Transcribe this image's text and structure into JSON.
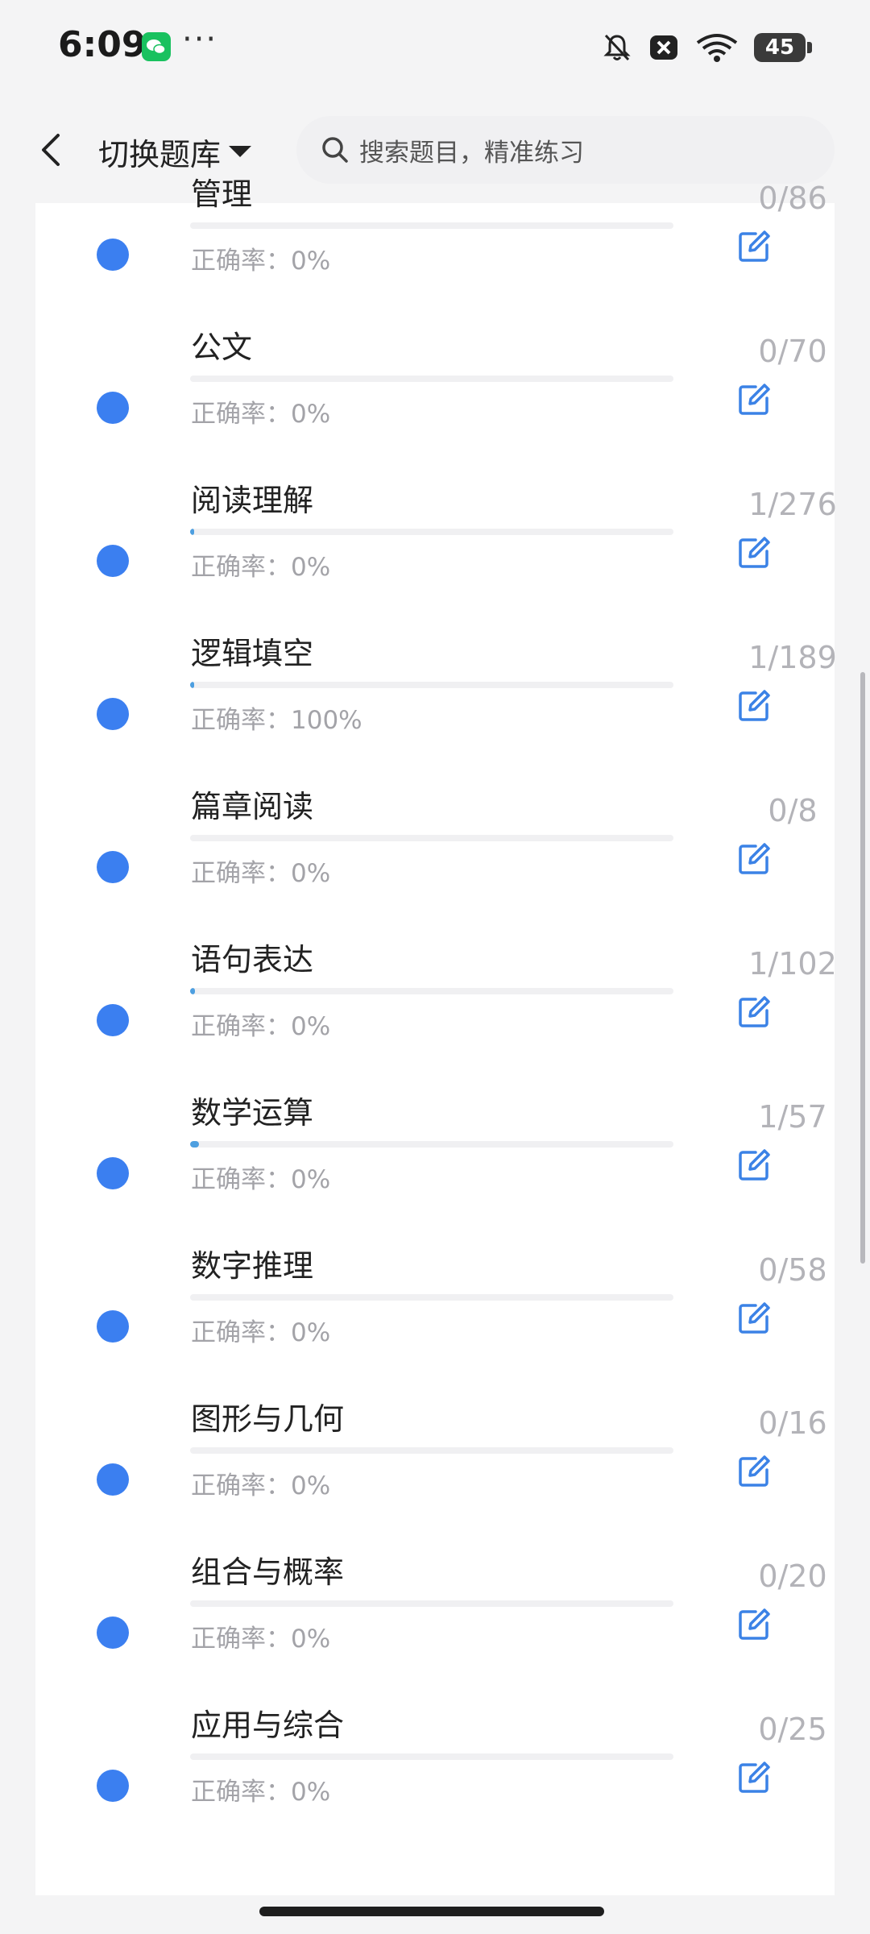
{
  "status": {
    "time": "6:09",
    "more": "···",
    "battery": "45"
  },
  "header": {
    "switch_label": "切换题库",
    "search_placeholder": "搜索题目，精准练习"
  },
  "topics": [
    {
      "title": "管理",
      "accuracy": "正确率：0%",
      "count": "0/86",
      "progress": 0
    },
    {
      "title": "公文",
      "accuracy": "正确率：0%",
      "count": "0/70",
      "progress": 0
    },
    {
      "title": "阅读理解",
      "accuracy": "正确率：0%",
      "count": "1/276",
      "progress": 0.0036
    },
    {
      "title": "逻辑填空",
      "accuracy": "正确率：100%",
      "count": "1/189",
      "progress": 0.0053
    },
    {
      "title": "篇章阅读",
      "accuracy": "正确率：0%",
      "count": "0/8",
      "progress": 0
    },
    {
      "title": "语句表达",
      "accuracy": "正确率：0%",
      "count": "1/102",
      "progress": 0.0098
    },
    {
      "title": "数学运算",
      "accuracy": "正确率：0%",
      "count": "1/57",
      "progress": 0.0175
    },
    {
      "title": "数字推理",
      "accuracy": "正确率：0%",
      "count": "0/58",
      "progress": 0
    },
    {
      "title": "图形与几何",
      "accuracy": "正确率：0%",
      "count": "0/16",
      "progress": 0
    },
    {
      "title": "组合与概率",
      "accuracy": "正确率：0%",
      "count": "0/20",
      "progress": 0
    },
    {
      "title": "应用与综合",
      "accuracy": "正确率：0%",
      "count": "0/25",
      "progress": 0
    }
  ],
  "colors": {
    "dot": "#3b7ff0",
    "edit_icon": "#3b82e6",
    "progress_fill": "#4d9fe0"
  }
}
